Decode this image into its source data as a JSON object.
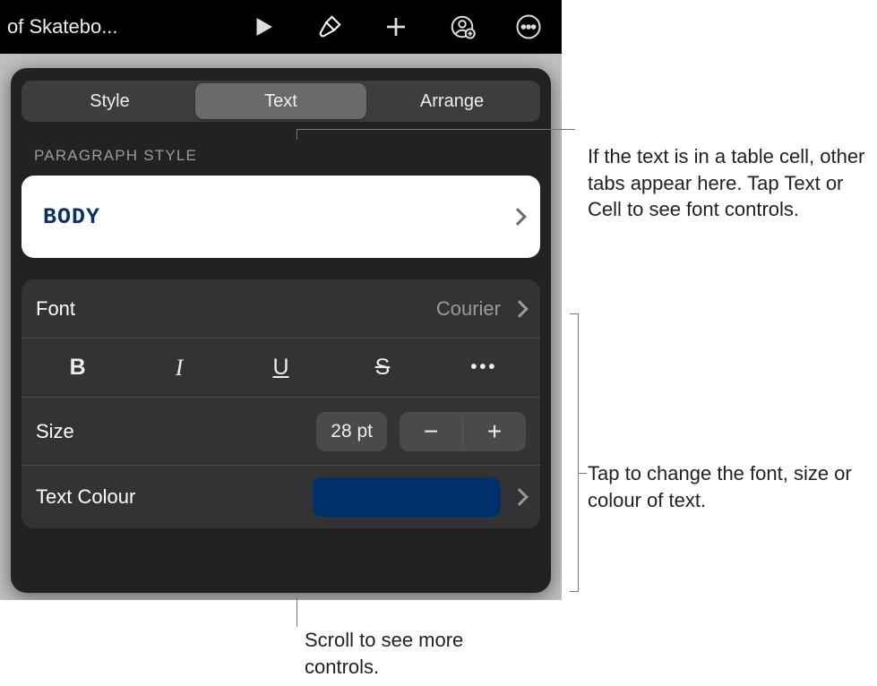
{
  "topbar": {
    "doc_title": "of Skatebo..."
  },
  "tabs": {
    "style": "Style",
    "text": "Text",
    "arrange": "Arrange"
  },
  "paragraph_style": {
    "section_label": "PARAGRAPH STYLE",
    "current": "BODY"
  },
  "font": {
    "label": "Font",
    "value": "Courier"
  },
  "format": {
    "bold": "B",
    "italic": "I",
    "underline": "U",
    "strike": "S",
    "more": "•••"
  },
  "size": {
    "label": "Size",
    "value": "28 pt",
    "minus": "−",
    "plus": "+"
  },
  "text_colour": {
    "label": "Text Colour",
    "swatch": "#00306b"
  },
  "callouts": {
    "c1": "If the text is in a table cell, other tabs appear here. Tap Text or Cell to see font controls.",
    "c2": "Tap to change the font, size or colour of text.",
    "c3": "Scroll to see more controls."
  }
}
